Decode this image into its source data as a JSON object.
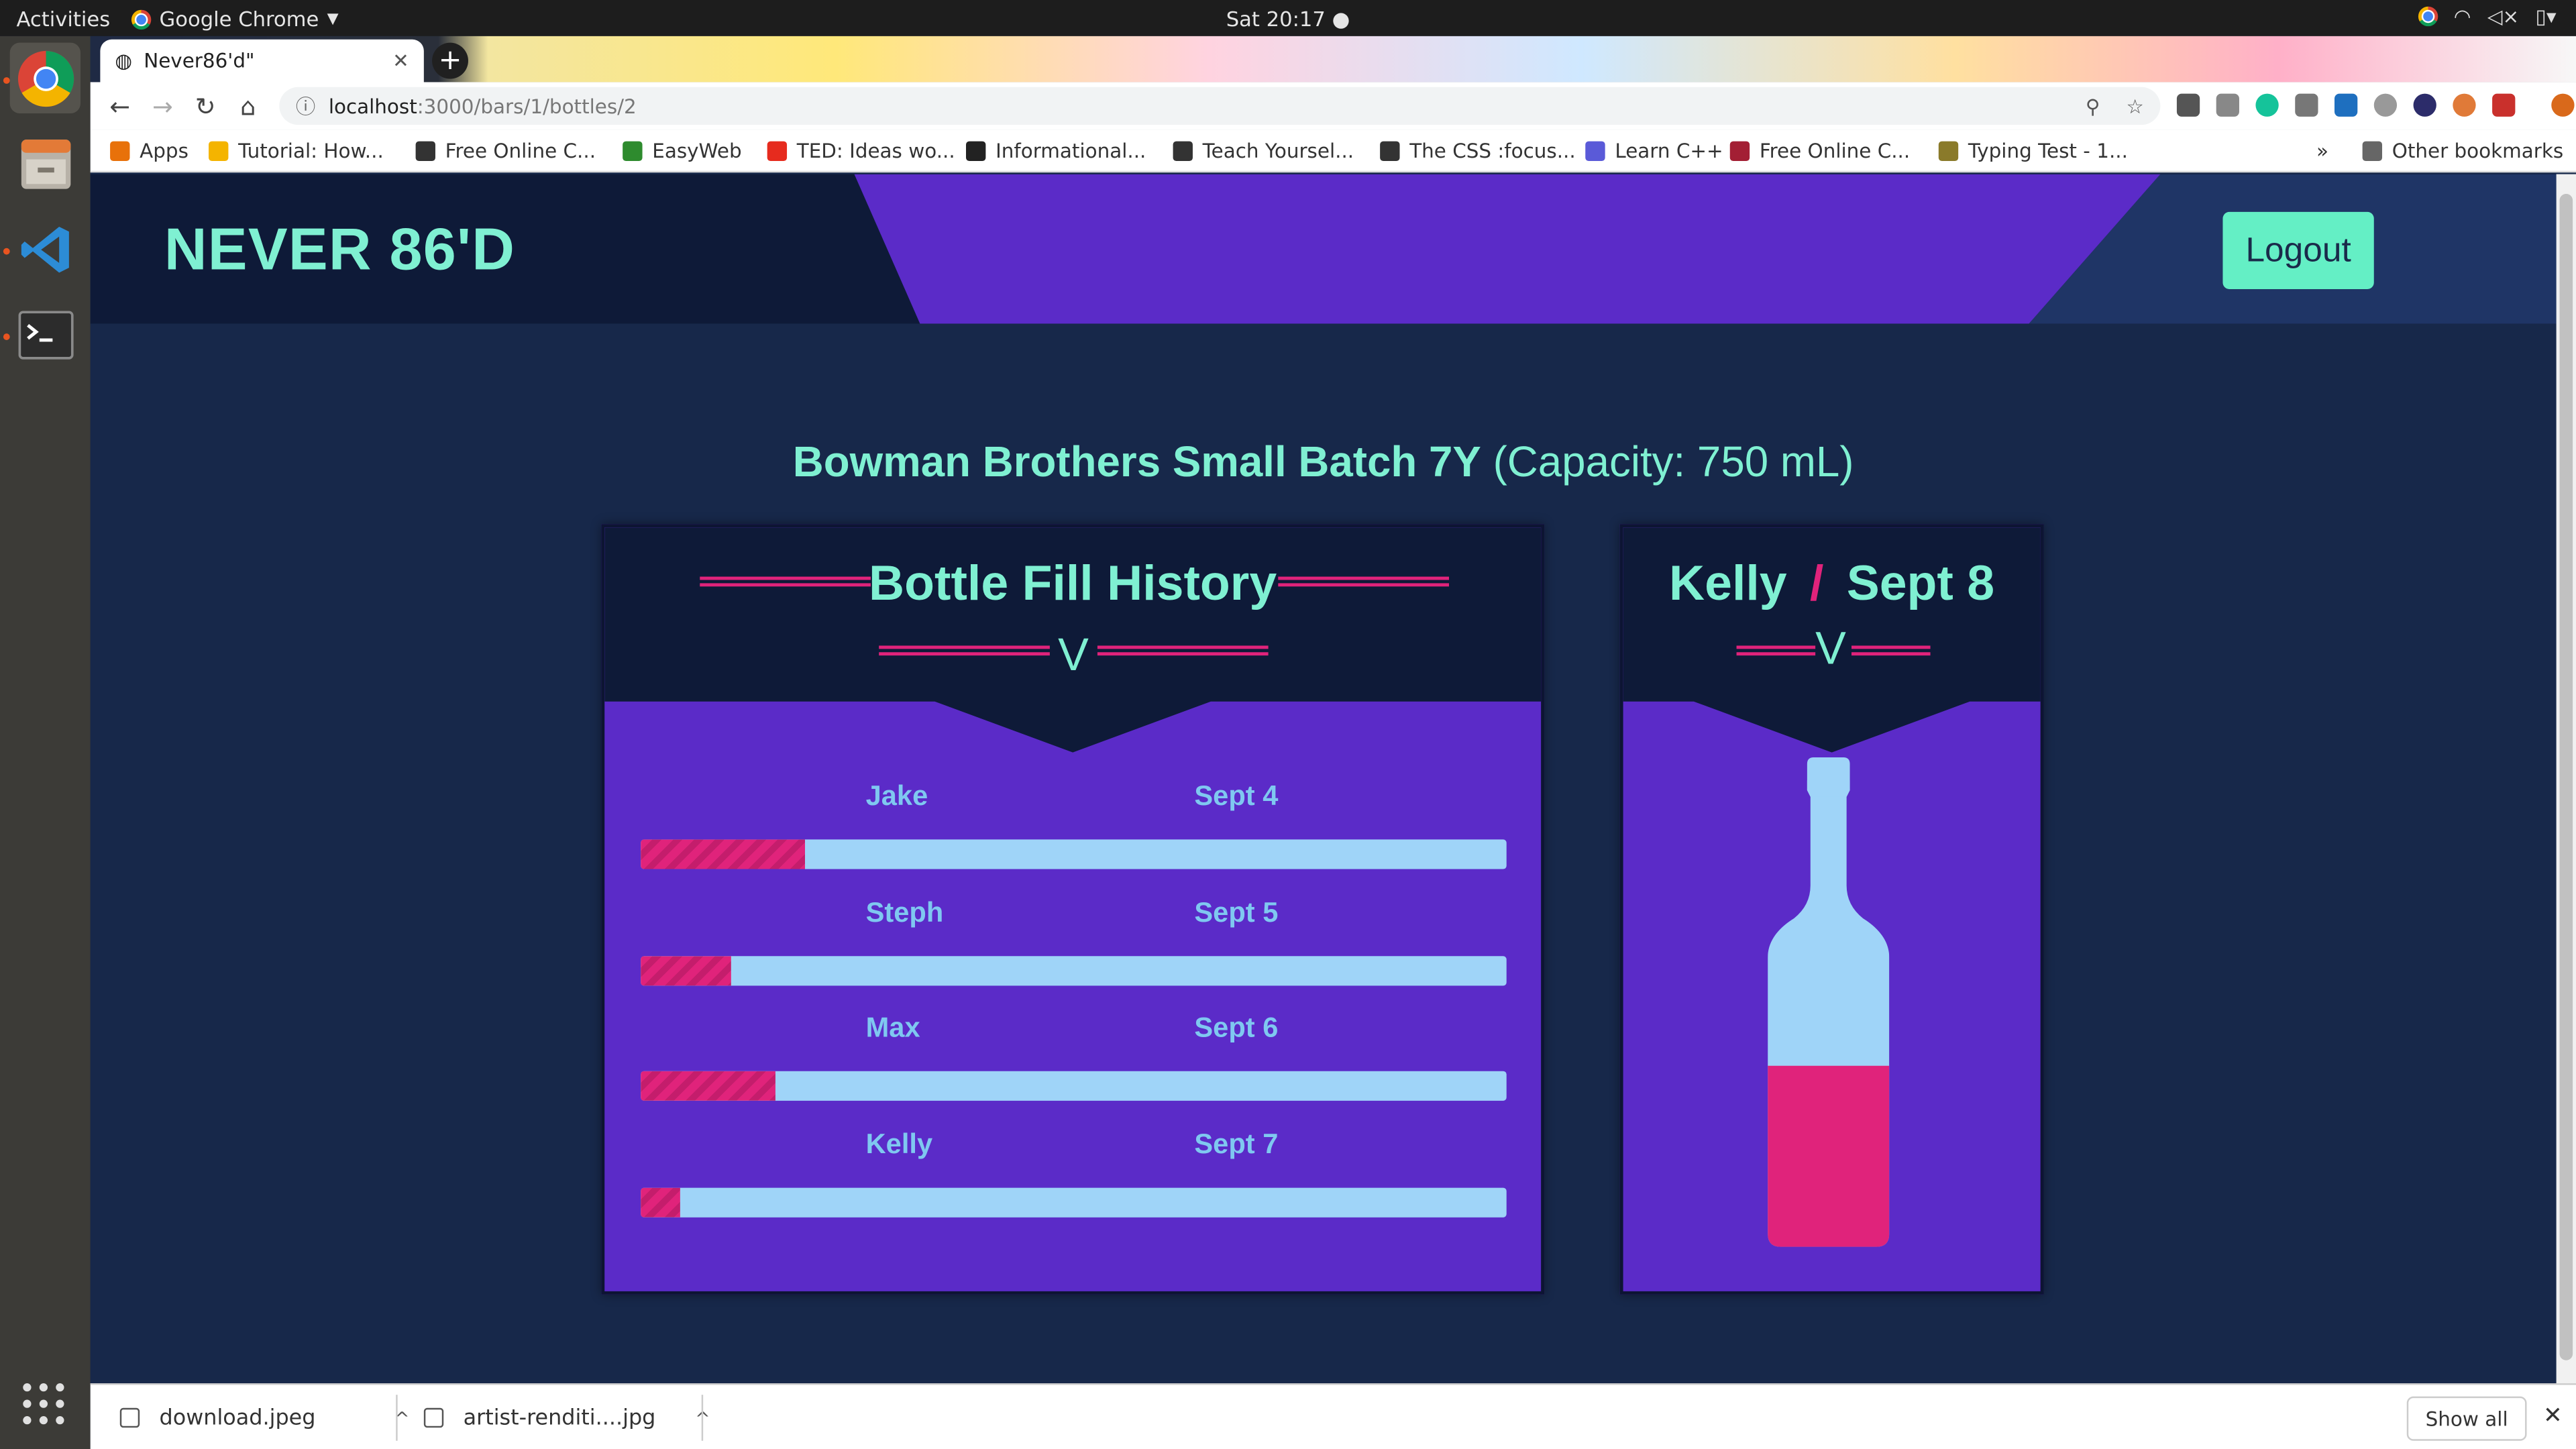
{
  "system": {
    "activities": "Activities",
    "app_name": "Google Chrome",
    "clock": "Sat 20:17 ●"
  },
  "browser": {
    "tab_title": "Never86'd\"",
    "url_host": "localhost",
    "url_path": ":3000/bars/1/bottles/2",
    "bookmarks": [
      {
        "label": "Apps",
        "icon": "apps-grid-icon",
        "color": "#e8710a"
      },
      {
        "label": "Tutorial: How...",
        "icon": "bookmark-icon",
        "color": "#f4b400"
      },
      {
        "label": "Free Online C...",
        "icon": "globe-icon",
        "color": "#333333"
      },
      {
        "label": "EasyWeb",
        "icon": "td-icon",
        "color": "#2e8b2e"
      },
      {
        "label": "TED: Ideas wo...",
        "icon": "ted-icon",
        "color": "#e62b1e"
      },
      {
        "label": "Informational...",
        "icon": "folder-icon",
        "color": "#222222"
      },
      {
        "label": "Teach Yoursel...",
        "icon": "globe-icon",
        "color": "#333333"
      },
      {
        "label": "The CSS :focus...",
        "icon": "globe-icon",
        "color": "#333333"
      },
      {
        "label": "Learn C++",
        "icon": "cpp-icon",
        "color": "#5a5ad8"
      },
      {
        "label": "Free Online C...",
        "icon": "mit-icon",
        "color": "#a31f34"
      },
      {
        "label": "Typing Test - 1...",
        "icon": "typing-icon",
        "color": "#8a7a2a"
      }
    ],
    "more_bookmarks": "»",
    "other_bookmarks": "Other bookmarks"
  },
  "app": {
    "logo": "NEVER 86'D",
    "logout_label": "Logout",
    "bottle_name": "Bowman Brothers Small Batch 7Y",
    "bottle_capacity": "(Capacity: 750 mL)",
    "history_title": "Bottle Fill History",
    "chevron": "V",
    "history": [
      {
        "name": "Jake",
        "date": "Sept 4",
        "fill_fraction": 0.19
      },
      {
        "name": "Steph",
        "date": "Sept 5",
        "fill_fraction": 0.105
      },
      {
        "name": "Max",
        "date": "Sept 6",
        "fill_fraction": 0.155
      },
      {
        "name": "Kelly",
        "date": "Sept 7",
        "fill_fraction": 0.045
      }
    ],
    "current": {
      "name": "Kelly",
      "separator": "/",
      "date": "Sept 8",
      "fill_fraction": 0.37
    },
    "colors": {
      "accent_mint": "#7ff0d2",
      "accent_pink": "#e0237b",
      "card_purple": "#5b2bc8",
      "bar_blue": "#9fd4f8",
      "page_bg": "#17284a"
    }
  },
  "downloads": {
    "items": [
      "download.jpeg",
      "artist-renditi....jpg"
    ],
    "show_all": "Show all"
  }
}
